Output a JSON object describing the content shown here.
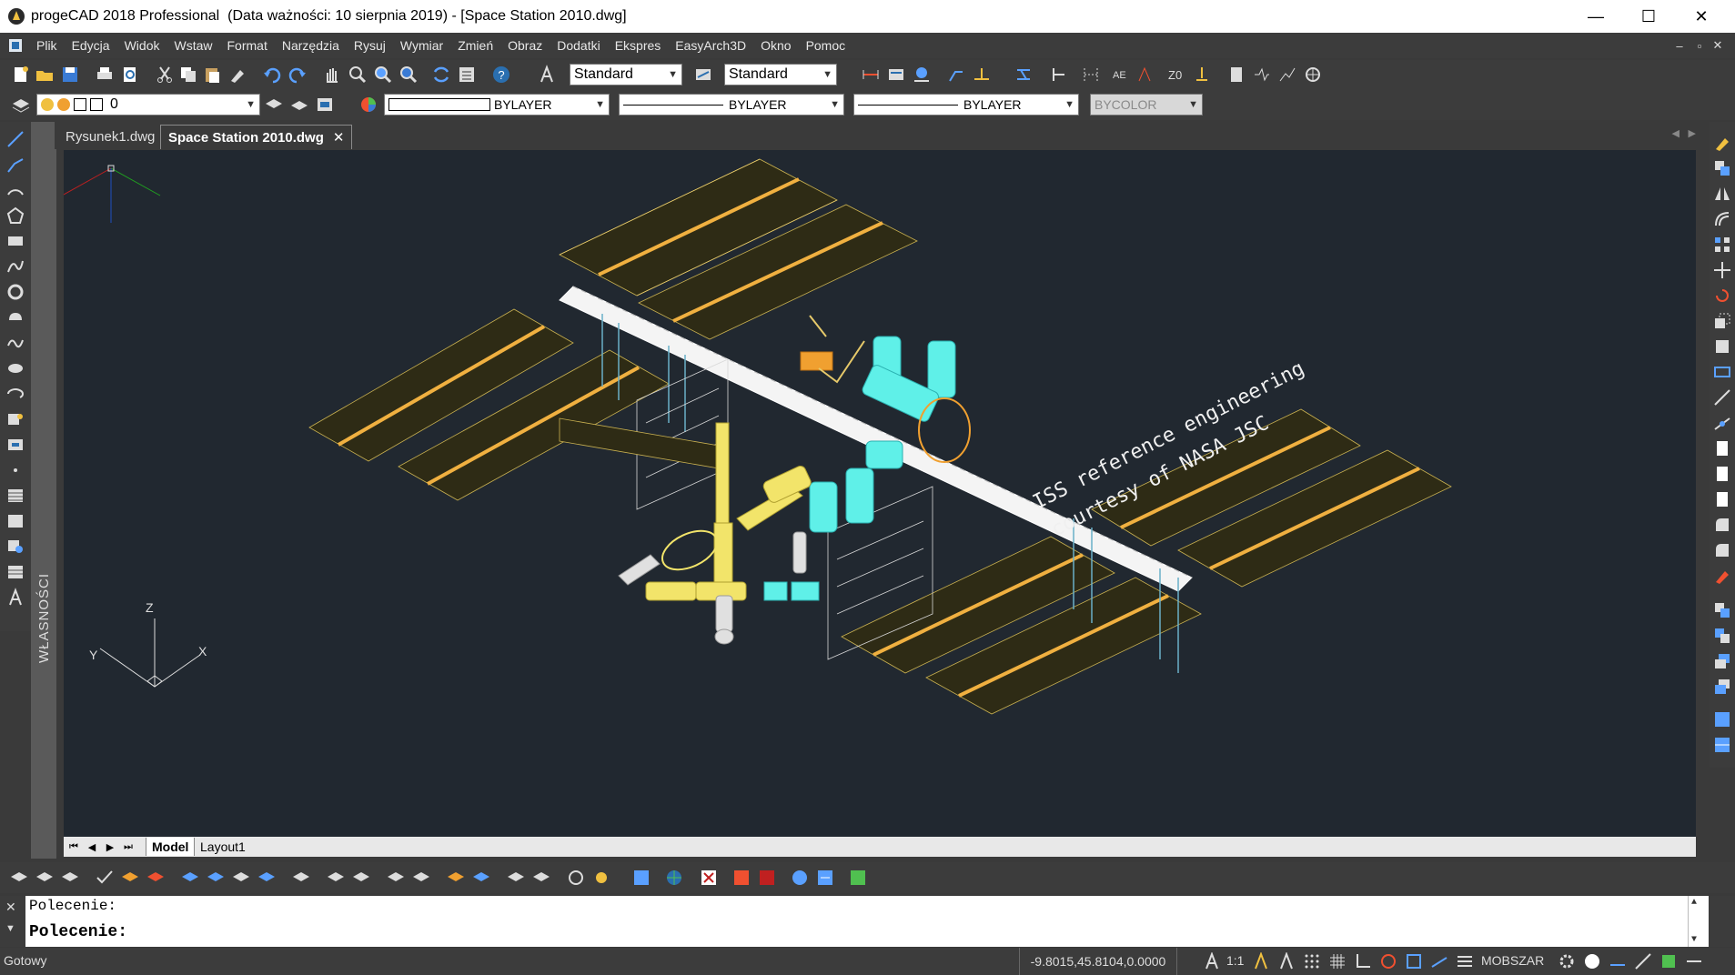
{
  "window": {
    "title": "progeCAD 2018 Professional  (Data ważności: 10 sierpnia 2019) - [Space Station 2010.dwg]",
    "minimize": "—",
    "maximize": "☐",
    "close": "✕"
  },
  "menu": {
    "items": [
      "Plik",
      "Edycja",
      "Widok",
      "Wstaw",
      "Format",
      "Narzędzia",
      "Rysuj",
      "Wymiar",
      "Zmień",
      "Obraz",
      "Dodatki",
      "Ekspres",
      "EasyArch3D",
      "Okno",
      "Pomoc"
    ],
    "mdi_min": "–",
    "mdi_restore": "▫",
    "mdi_close": "✕"
  },
  "toolbar1": {
    "text_style": "Standard",
    "dim_style": "Standard"
  },
  "toolbar2": {
    "layer": "0",
    "color": "BYLAYER",
    "linetype": "BYLAYER",
    "lineweight": "BYLAYER",
    "plotstyle": "BYCOLOR"
  },
  "tabs": [
    {
      "label": "Rysunek1.dwg",
      "active": false
    },
    {
      "label": "Space Station 2010.dwg",
      "active": true
    }
  ],
  "tab_close": "✕",
  "properties_panel_label": "WŁASNOŚCI",
  "drawing": {
    "annotation_line1": "ISS reference engineering",
    "annotation_line2": "courtesy of NASA JSC",
    "ucs": {
      "z": "Z",
      "y": "Y",
      "x": "X"
    }
  },
  "layout_tabs": [
    "Model",
    "Layout1"
  ],
  "command": {
    "history": "Polecenie:",
    "prompt": "Polecenie:"
  },
  "status": {
    "state": "Gotowy",
    "coordinates": "-9.8015,45.8104,0.0000",
    "scale": "1:1",
    "space": "MOBSZAR"
  },
  "colors": {
    "viewport_bg": "#212830",
    "panel_bg": "#3c3c3c",
    "solar_panel": "#e6c96a",
    "truss": "#ffffff",
    "module_cyan": "#5ff0e8",
    "module_yellow": "#f2e46a",
    "orange": "#f0a030"
  }
}
